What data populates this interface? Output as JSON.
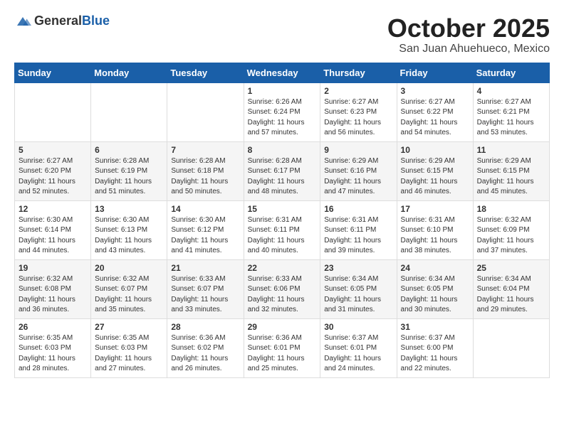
{
  "header": {
    "logo_general": "General",
    "logo_blue": "Blue",
    "month_title": "October 2025",
    "location": "San Juan Ahuehueco, Mexico"
  },
  "weekdays": [
    "Sunday",
    "Monday",
    "Tuesday",
    "Wednesday",
    "Thursday",
    "Friday",
    "Saturday"
  ],
  "weeks": [
    [
      {
        "day": "",
        "info": ""
      },
      {
        "day": "",
        "info": ""
      },
      {
        "day": "",
        "info": ""
      },
      {
        "day": "1",
        "info": "Sunrise: 6:26 AM\nSunset: 6:24 PM\nDaylight: 11 hours and 57 minutes."
      },
      {
        "day": "2",
        "info": "Sunrise: 6:27 AM\nSunset: 6:23 PM\nDaylight: 11 hours and 56 minutes."
      },
      {
        "day": "3",
        "info": "Sunrise: 6:27 AM\nSunset: 6:22 PM\nDaylight: 11 hours and 54 minutes."
      },
      {
        "day": "4",
        "info": "Sunrise: 6:27 AM\nSunset: 6:21 PM\nDaylight: 11 hours and 53 minutes."
      }
    ],
    [
      {
        "day": "5",
        "info": "Sunrise: 6:27 AM\nSunset: 6:20 PM\nDaylight: 11 hours and 52 minutes."
      },
      {
        "day": "6",
        "info": "Sunrise: 6:28 AM\nSunset: 6:19 PM\nDaylight: 11 hours and 51 minutes."
      },
      {
        "day": "7",
        "info": "Sunrise: 6:28 AM\nSunset: 6:18 PM\nDaylight: 11 hours and 50 minutes."
      },
      {
        "day": "8",
        "info": "Sunrise: 6:28 AM\nSunset: 6:17 PM\nDaylight: 11 hours and 48 minutes."
      },
      {
        "day": "9",
        "info": "Sunrise: 6:29 AM\nSunset: 6:16 PM\nDaylight: 11 hours and 47 minutes."
      },
      {
        "day": "10",
        "info": "Sunrise: 6:29 AM\nSunset: 6:15 PM\nDaylight: 11 hours and 46 minutes."
      },
      {
        "day": "11",
        "info": "Sunrise: 6:29 AM\nSunset: 6:15 PM\nDaylight: 11 hours and 45 minutes."
      }
    ],
    [
      {
        "day": "12",
        "info": "Sunrise: 6:30 AM\nSunset: 6:14 PM\nDaylight: 11 hours and 44 minutes."
      },
      {
        "day": "13",
        "info": "Sunrise: 6:30 AM\nSunset: 6:13 PM\nDaylight: 11 hours and 43 minutes."
      },
      {
        "day": "14",
        "info": "Sunrise: 6:30 AM\nSunset: 6:12 PM\nDaylight: 11 hours and 41 minutes."
      },
      {
        "day": "15",
        "info": "Sunrise: 6:31 AM\nSunset: 6:11 PM\nDaylight: 11 hours and 40 minutes."
      },
      {
        "day": "16",
        "info": "Sunrise: 6:31 AM\nSunset: 6:11 PM\nDaylight: 11 hours and 39 minutes."
      },
      {
        "day": "17",
        "info": "Sunrise: 6:31 AM\nSunset: 6:10 PM\nDaylight: 11 hours and 38 minutes."
      },
      {
        "day": "18",
        "info": "Sunrise: 6:32 AM\nSunset: 6:09 PM\nDaylight: 11 hours and 37 minutes."
      }
    ],
    [
      {
        "day": "19",
        "info": "Sunrise: 6:32 AM\nSunset: 6:08 PM\nDaylight: 11 hours and 36 minutes."
      },
      {
        "day": "20",
        "info": "Sunrise: 6:32 AM\nSunset: 6:07 PM\nDaylight: 11 hours and 35 minutes."
      },
      {
        "day": "21",
        "info": "Sunrise: 6:33 AM\nSunset: 6:07 PM\nDaylight: 11 hours and 33 minutes."
      },
      {
        "day": "22",
        "info": "Sunrise: 6:33 AM\nSunset: 6:06 PM\nDaylight: 11 hours and 32 minutes."
      },
      {
        "day": "23",
        "info": "Sunrise: 6:34 AM\nSunset: 6:05 PM\nDaylight: 11 hours and 31 minutes."
      },
      {
        "day": "24",
        "info": "Sunrise: 6:34 AM\nSunset: 6:05 PM\nDaylight: 11 hours and 30 minutes."
      },
      {
        "day": "25",
        "info": "Sunrise: 6:34 AM\nSunset: 6:04 PM\nDaylight: 11 hours and 29 minutes."
      }
    ],
    [
      {
        "day": "26",
        "info": "Sunrise: 6:35 AM\nSunset: 6:03 PM\nDaylight: 11 hours and 28 minutes."
      },
      {
        "day": "27",
        "info": "Sunrise: 6:35 AM\nSunset: 6:03 PM\nDaylight: 11 hours and 27 minutes."
      },
      {
        "day": "28",
        "info": "Sunrise: 6:36 AM\nSunset: 6:02 PM\nDaylight: 11 hours and 26 minutes."
      },
      {
        "day": "29",
        "info": "Sunrise: 6:36 AM\nSunset: 6:01 PM\nDaylight: 11 hours and 25 minutes."
      },
      {
        "day": "30",
        "info": "Sunrise: 6:37 AM\nSunset: 6:01 PM\nDaylight: 11 hours and 24 minutes."
      },
      {
        "day": "31",
        "info": "Sunrise: 6:37 AM\nSunset: 6:00 PM\nDaylight: 11 hours and 22 minutes."
      },
      {
        "day": "",
        "info": ""
      }
    ]
  ]
}
